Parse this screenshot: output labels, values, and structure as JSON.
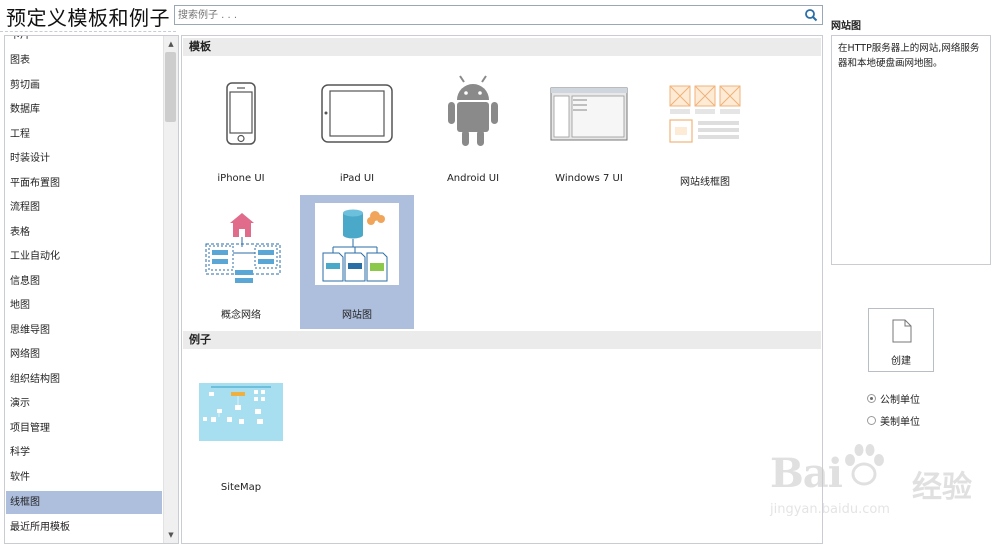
{
  "header": {
    "title": "预定义模板和例子"
  },
  "search": {
    "placeholder": "搜索例子 . . ."
  },
  "categories": [
    {
      "label": "卡片"
    },
    {
      "label": "图表"
    },
    {
      "label": "剪切画"
    },
    {
      "label": "数据库"
    },
    {
      "label": "工程"
    },
    {
      "label": "时装设计"
    },
    {
      "label": "平面布置图"
    },
    {
      "label": "流程图"
    },
    {
      "label": "表格"
    },
    {
      "label": "工业自动化"
    },
    {
      "label": "信息图"
    },
    {
      "label": "地图"
    },
    {
      "label": "思维导图"
    },
    {
      "label": "网络图"
    },
    {
      "label": "组织结构图"
    },
    {
      "label": "演示"
    },
    {
      "label": "项目管理"
    },
    {
      "label": "科学"
    },
    {
      "label": "软件"
    },
    {
      "label": "线框图"
    },
    {
      "label": "最近所用模板"
    }
  ],
  "selected_category": "线框图",
  "templates_section": {
    "title": "模板",
    "items": [
      {
        "label": "iPhone UI",
        "icon": "iphone-icon"
      },
      {
        "label": "iPad UI",
        "icon": "ipad-icon"
      },
      {
        "label": "Android UI",
        "icon": "android-icon"
      },
      {
        "label": "Windows 7 UI",
        "icon": "windows-window-icon"
      },
      {
        "label": "网站线框图",
        "icon": "website-wireframe-icon"
      },
      {
        "label": "概念网络",
        "icon": "concept-network-icon"
      },
      {
        "label": "网站图",
        "icon": "sitemap-icon"
      }
    ],
    "selected": "网站图"
  },
  "examples_section": {
    "title": "例子",
    "items": [
      {
        "label": "SiteMap"
      }
    ]
  },
  "details": {
    "title": "网站图",
    "description": "在HTTP服务器上的网站,网络服务器和本地硬盘画网地图。"
  },
  "create_button": {
    "label": "创建"
  },
  "units": {
    "options": [
      {
        "label": "公制单位",
        "checked": true
      },
      {
        "label": "美制单位",
        "checked": false
      }
    ]
  },
  "watermark": {
    "main": "Bai",
    "cn": "经验",
    "url": "jingyan.baidu.com"
  },
  "colors": {
    "selection": "#aebfde",
    "section_header": "#ebebeb",
    "accent_blue": "#2a6ea6"
  }
}
